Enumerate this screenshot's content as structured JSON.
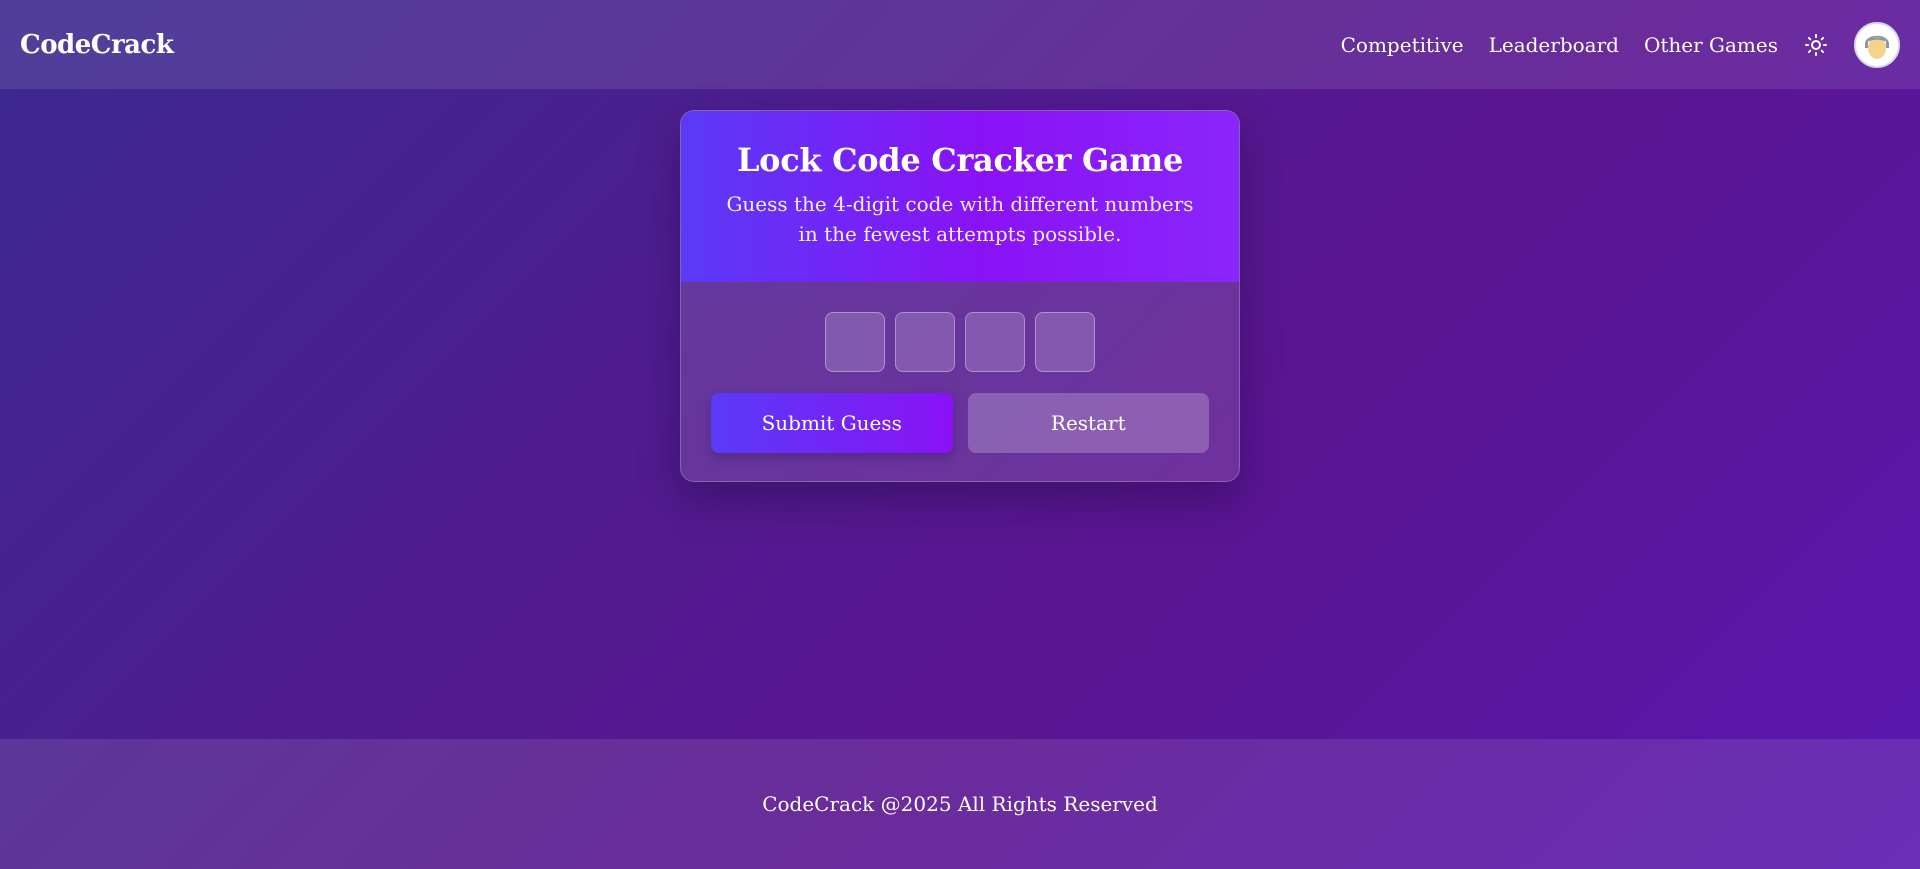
{
  "navbar": {
    "brand": "CodeCrack",
    "links": [
      "Competitive",
      "Leaderboard",
      "Other Games"
    ],
    "theme_icon": "sun-icon",
    "avatar_icon": "user-avatar"
  },
  "game": {
    "title": "Lock Code Cracker Game",
    "subtitle": "Guess the 4-digit code with different numbers in the fewest attempts possible.",
    "digits": [
      "",
      "",
      "",
      ""
    ],
    "submit_label": "Submit Guess",
    "restart_label": "Restart"
  },
  "footer": {
    "text": "CodeCrack @2025 All Rights Reserved"
  },
  "colors": {
    "background_start": "#3b2a8f",
    "background_end": "#5a17b0",
    "header_gradient_start": "#5a3af7",
    "header_gradient_end": "#8a12f5",
    "text": "#ffffff"
  }
}
